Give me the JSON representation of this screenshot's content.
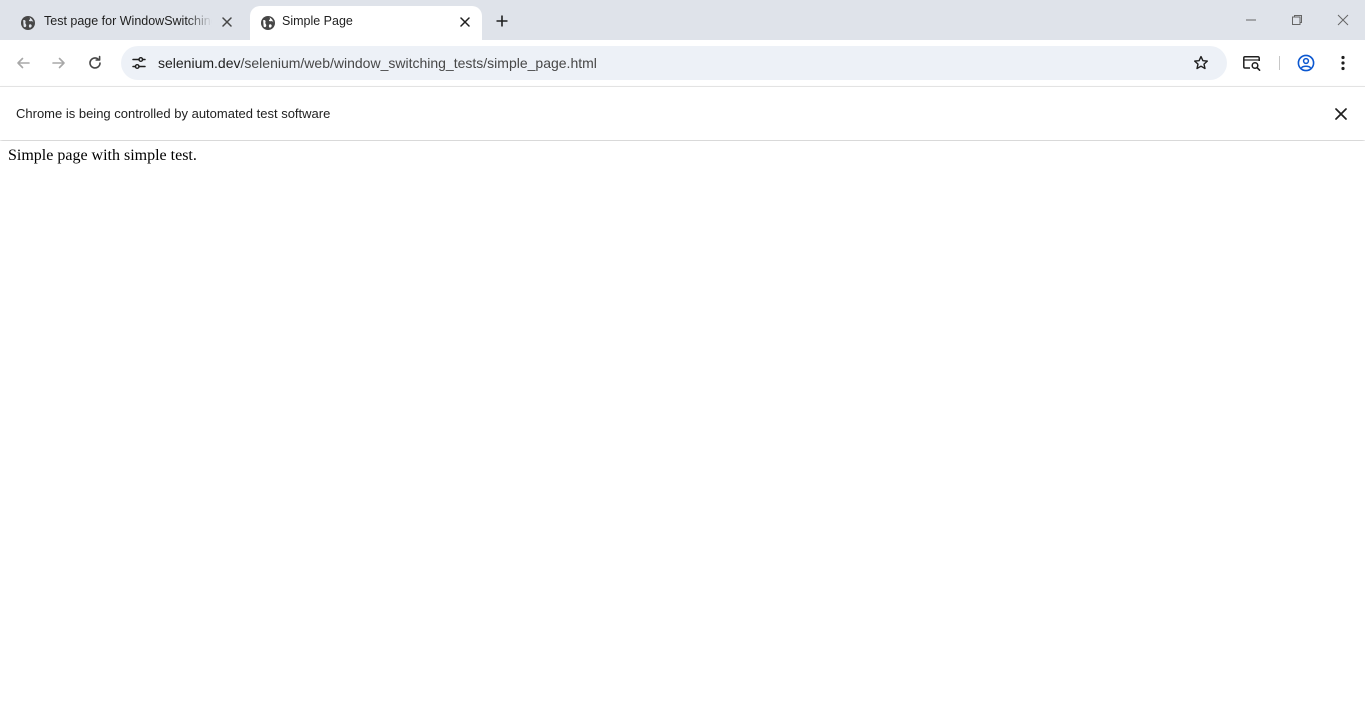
{
  "browser": {
    "tabs": [
      {
        "title": "Test page for WindowSwitching",
        "active": false,
        "favicon": "globe-icon"
      },
      {
        "title": "Simple Page",
        "active": true,
        "favicon": "globe-icon"
      }
    ],
    "new_tab_icon": "plus-icon",
    "window_controls": [
      "minimize-icon",
      "restore-icon",
      "close-icon"
    ],
    "toolbar": {
      "back_icon": "arrow-back-icon",
      "forward_icon": "arrow-forward-icon",
      "reload_icon": "reload-icon",
      "site_info_icon": "tune-icon",
      "url_host": "selenium.dev",
      "url_path": "/selenium/web/window_switching_tests/simple_page.html",
      "bookmark_icon": "star-icon",
      "media_icon": "cast-search-icon",
      "profile_icon": "account-circle-icon",
      "menu_icon": "kebab-menu-icon"
    },
    "infobar": {
      "message": "Chrome is being controlled by automated test software",
      "close_icon": "close-icon"
    }
  },
  "page": {
    "text": "Simple page with simple test."
  },
  "colors": {
    "tabstrip_bg": "#dfe3ea",
    "omnibox_bg": "#edf1f7",
    "page_bg": "#ffffff"
  }
}
